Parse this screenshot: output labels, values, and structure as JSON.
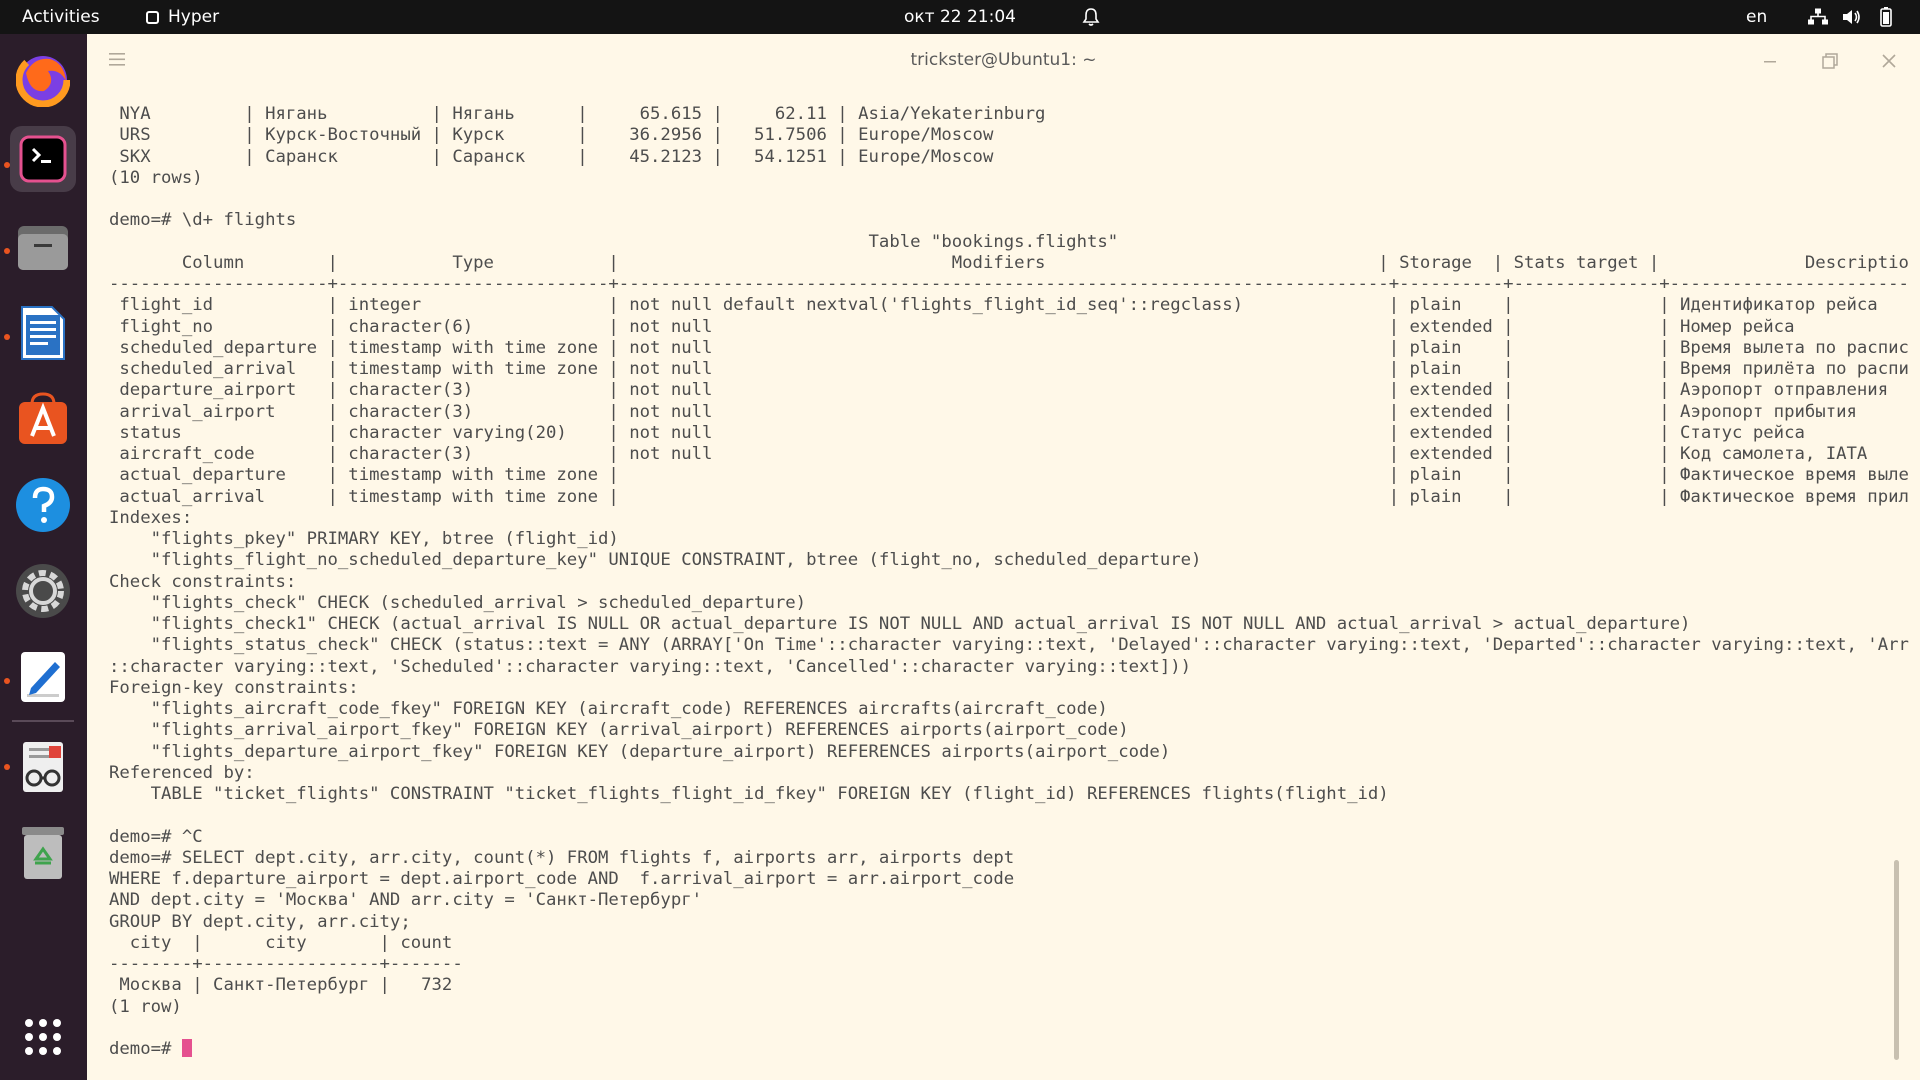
{
  "topbar": {
    "activities": "Activities",
    "app_name": "Hyper",
    "clock": "окт 22  21:04",
    "lang": "en"
  },
  "dock": {
    "items": [
      {
        "name": "firefox",
        "active": false
      },
      {
        "name": "terminal",
        "active": true
      },
      {
        "name": "files",
        "active": false
      },
      {
        "name": "writer",
        "active": false
      },
      {
        "name": "software",
        "active": false
      },
      {
        "name": "help",
        "active": false
      },
      {
        "name": "settings",
        "active": false
      },
      {
        "name": "text-editor",
        "active": false
      },
      {
        "name": "document-viewer",
        "active": false
      },
      {
        "name": "trash",
        "active": false
      },
      {
        "name": "show-apps",
        "active": false
      }
    ]
  },
  "window": {
    "title": "trickster@Ubuntu1: ~"
  },
  "terminal": {
    "lines": [
      " NYA         | Нягань          | Нягань      |     65.615 |     62.11 | Asia/Yekaterinburg",
      " URS         | Курск-Восточный | Курск       |    36.2956 |   51.7506 | Europe/Moscow",
      " SKX         | Саранск         | Саранск     |    45.2123 |   54.1251 | Europe/Moscow",
      "(10 rows)",
      "",
      "demo=# \\d+ flights",
      "                                                                         Table \"bookings.flights\"",
      "       Column        |           Type           |                                Modifiers                                | Storage  | Stats target |              Description",
      "---------------------+--------------------------+--------------------------------------------------------------------------+----------+--------------+----------------------------------------",
      " flight_id           | integer                  | not null default nextval('flights_flight_id_seq'::regclass)              | plain    |              | Идентификатор рейса",
      " flight_no           | character(6)             | not null                                                                 | extended |              | Номер рейса",
      " scheduled_departure | timestamp with time zone | not null                                                                 | plain    |              | Время вылета по расписанию",
      " scheduled_arrival   | timestamp with time zone | not null                                                                 | plain    |              | Время прилёта по расписанию",
      " departure_airport   | character(3)             | not null                                                                 | extended |              | Аэропорт отправления",
      " arrival_airport     | character(3)             | not null                                                                 | extended |              | Аэропорт прибытия",
      " status              | character varying(20)    | not null                                                                 | extended |              | Статус рейса",
      " aircraft_code       | character(3)             | not null                                                                 | extended |              | Код самолета, IATA",
      " actual_departure    | timestamp with time zone |                                                                          | plain    |              | Фактическое время вылета",
      " actual_arrival      | timestamp with time zone |                                                                          | plain    |              | Фактическое время прилёта",
      "Indexes:",
      "    \"flights_pkey\" PRIMARY KEY, btree (flight_id)",
      "    \"flights_flight_no_scheduled_departure_key\" UNIQUE CONSTRAINT, btree (flight_no, scheduled_departure)",
      "Check constraints:",
      "    \"flights_check\" CHECK (scheduled_arrival > scheduled_departure)",
      "    \"flights_check1\" CHECK (actual_arrival IS NULL OR actual_departure IS NOT NULL AND actual_arrival IS NOT NULL AND actual_arrival > actual_departure)",
      "    \"flights_status_check\" CHECK (status::text = ANY (ARRAY['On Time'::character varying::text, 'Delayed'::character varying::text, 'Departed'::character varying::text, 'Arrived'",
      "::character varying::text, 'Scheduled'::character varying::text, 'Cancelled'::character varying::text]))",
      "Foreign-key constraints:",
      "    \"flights_aircraft_code_fkey\" FOREIGN KEY (aircraft_code) REFERENCES aircrafts(aircraft_code)",
      "    \"flights_arrival_airport_fkey\" FOREIGN KEY (arrival_airport) REFERENCES airports(airport_code)",
      "    \"flights_departure_airport_fkey\" FOREIGN KEY (departure_airport) REFERENCES airports(airport_code)",
      "Referenced by:",
      "    TABLE \"ticket_flights\" CONSTRAINT \"ticket_flights_flight_id_fkey\" FOREIGN KEY (flight_id) REFERENCES flights(flight_id)",
      "",
      "demo=# ^C",
      "demo=# SELECT dept.city, arr.city, count(*) FROM flights f, airports arr, airports dept",
      "WHERE f.departure_airport = dept.airport_code AND  f.arrival_airport = arr.airport_code",
      "AND dept.city = 'Москва' AND arr.city = 'Санкт-Петербург'",
      "GROUP BY dept.city, arr.city;",
      "  city  |      city       | count",
      "--------+-----------------+-------",
      " Москва | Санкт-Петербург |   732",
      "(1 row)",
      ""
    ],
    "prompt": "demo=# "
  }
}
